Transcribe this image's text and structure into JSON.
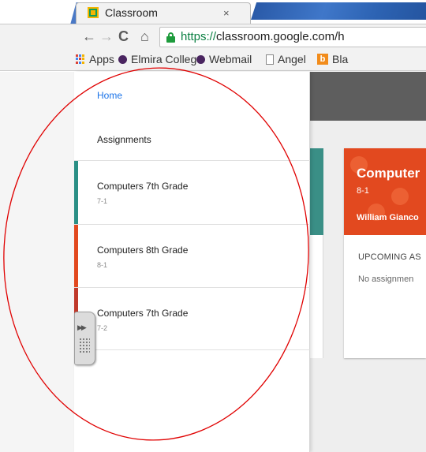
{
  "browser": {
    "tab_title": "Classroom",
    "tab_close": "×",
    "url_scheme": "https://",
    "url_rest": "classroom.google.com/h",
    "nav": {
      "back": "←",
      "forward": "→",
      "reload": "C",
      "home": "⌂"
    },
    "bookmarks": [
      {
        "label": "Apps",
        "icon": "apps-grid-icon"
      },
      {
        "label": "Elmira College",
        "icon": "dot-icon"
      },
      {
        "label": "Webmail",
        "icon": "dot-icon"
      },
      {
        "label": "Angel",
        "icon": "page-icon"
      },
      {
        "label": "Bla",
        "icon": "b-icon"
      }
    ]
  },
  "drawer": {
    "home": "Home",
    "assignments": "Assignments",
    "classes": [
      {
        "name": "Computers 7th Grade",
        "section": "7-1",
        "color": "#2a8f85"
      },
      {
        "name": "Computers 8th Grade",
        "section": "8-1",
        "color": "#e2491f"
      },
      {
        "name": "Computers 7th Grade",
        "section": "7-2",
        "color": "#c0392b"
      }
    ]
  },
  "card": {
    "title": "Computer",
    "section": "8-1",
    "teacher": "William Gianco",
    "upcoming": "UPCOMING AS",
    "no_assignments": "No assignmen"
  },
  "colors": {
    "accent_link": "#1a73e8",
    "card_header": "#e2491f",
    "annotation": "#e00000"
  }
}
